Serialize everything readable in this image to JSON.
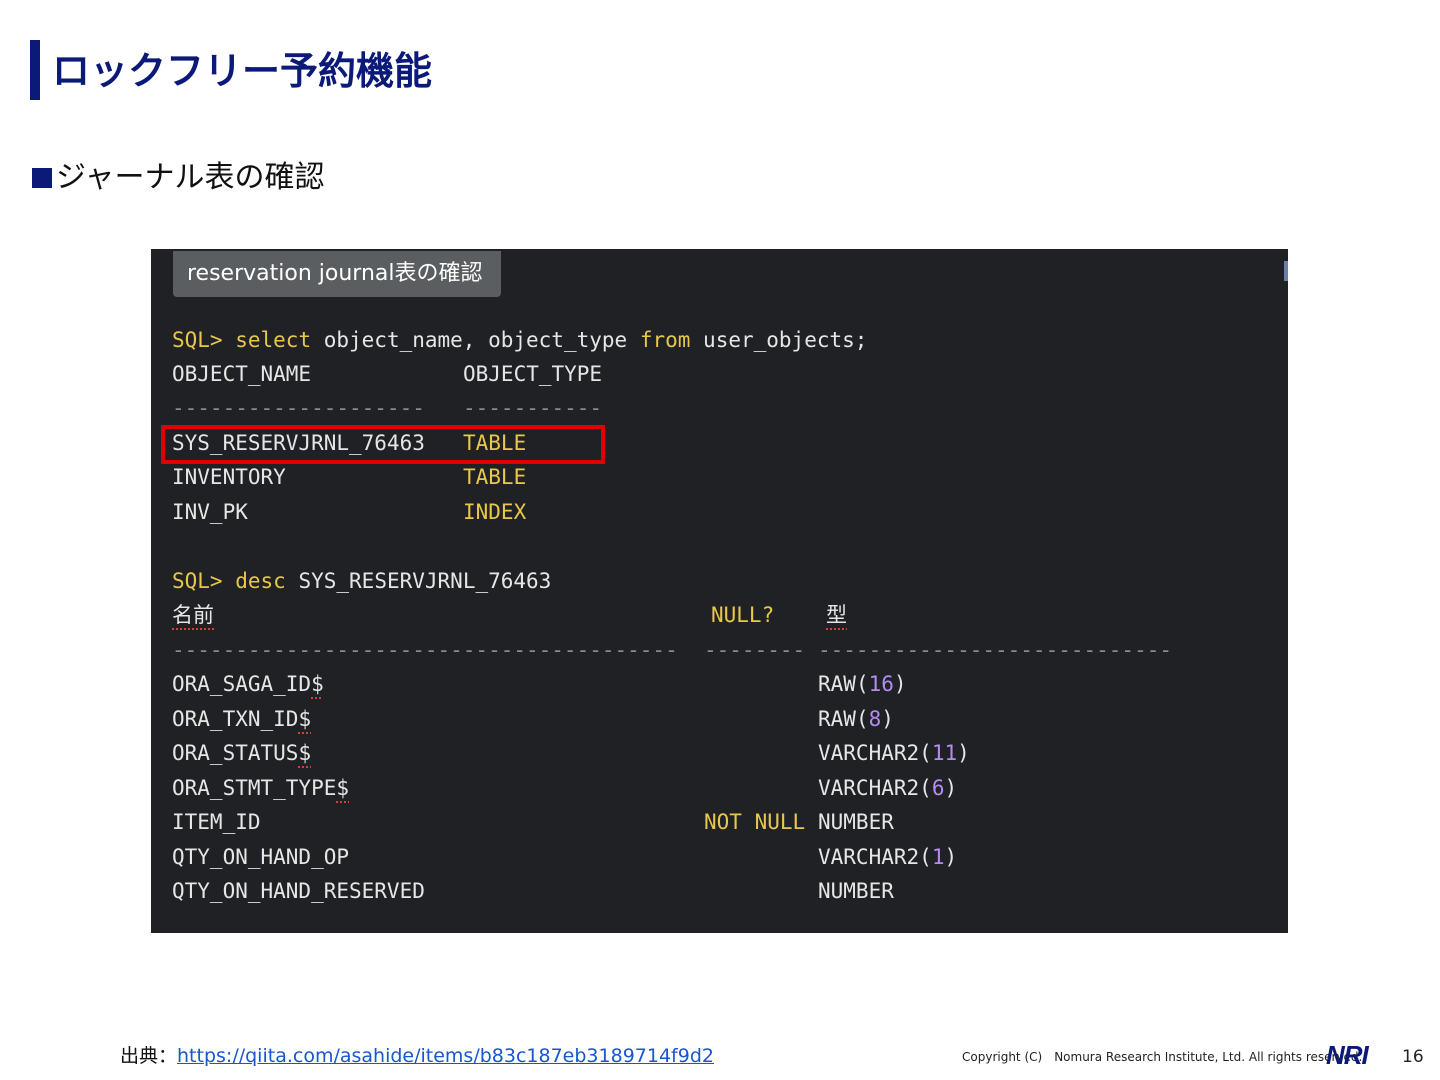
{
  "slide": {
    "title": "ロックフリー予約機能",
    "subtitle": "ジャーナル表の確認"
  },
  "terminal": {
    "tab_label": "reservation journal表の確認",
    "query1": {
      "prompt": "SQL>",
      "keyword1": "select",
      "text1": " object_name, object_type ",
      "keyword2": "from",
      "text2": " user_objects;"
    },
    "objects_header": {
      "name": "OBJECT_NAME",
      "type": "OBJECT_TYPE"
    },
    "objects_separator": {
      "name": "--------------------",
      "type": "-----------"
    },
    "objects": [
      {
        "name": "SYS_RESERVJRNL_76463",
        "type": "TABLE"
      },
      {
        "name": "INVENTORY",
        "type": "TABLE"
      },
      {
        "name": "INV_PK",
        "type": "INDEX"
      }
    ],
    "query2": {
      "prompt": "SQL>",
      "keyword": "desc",
      "text": " SYS_RESERVJRNL_76463"
    },
    "desc_header": {
      "name": "名前",
      "null": "NULL?",
      "type": "型"
    },
    "desc_separator": {
      "name": "----------------------------------------",
      "null": "--------",
      "type": "----------------------------"
    },
    "columns": [
      {
        "name_base": "ORA_SAGA_ID",
        "name_suffix": "$",
        "null": "",
        "type": "RAW",
        "size": "16"
      },
      {
        "name_base": "ORA_TXN_ID",
        "name_suffix": "$",
        "null": "",
        "type": "RAW",
        "size": "8"
      },
      {
        "name_base": "ORA_STATUS",
        "name_suffix": "$",
        "null": "",
        "type": "VARCHAR2",
        "size": "11"
      },
      {
        "name_base": "ORA_STMT_TYPE",
        "name_suffix": "$",
        "null": "",
        "type": "VARCHAR2",
        "size": "6"
      },
      {
        "name_base": "ITEM_ID",
        "name_suffix": "",
        "null": "NOT NULL",
        "type": "NUMBER",
        "size": ""
      },
      {
        "name_base": "QTY_ON_HAND_OP",
        "name_suffix": "",
        "null": "",
        "type": "VARCHAR2",
        "size": "1"
      },
      {
        "name_base": "QTY_ON_HAND_RESERVED",
        "name_suffix": "",
        "null": "",
        "type": "NUMBER",
        "size": ""
      }
    ]
  },
  "footer": {
    "source_label": "出典：",
    "source_url": "https://qiita.com/asahide/items/b83c187eb3189714f9d2",
    "copyright": "Copyright (C)　Nomura Research Institute, Ltd. All rights reserved.",
    "logo": "NRI",
    "page_number": "16"
  },
  "colors": {
    "brand": "#0b1a78",
    "terminal_bg": "#1f2125",
    "keyword": "#e8c84a",
    "number": "#b48cf0",
    "highlight_box": "#e00000"
  }
}
